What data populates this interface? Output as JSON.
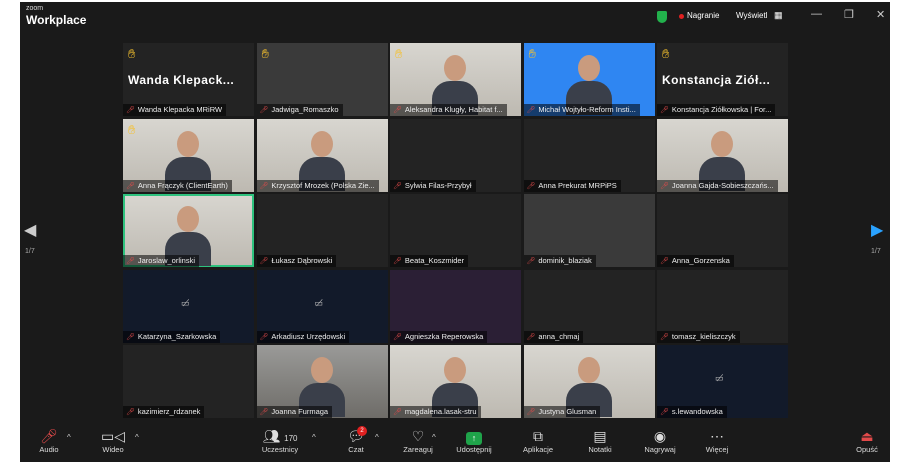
{
  "titlebar": {
    "logo_small": "zoom",
    "logo_big": "Workplace",
    "recording_label": "Nagranie",
    "view_label": "Wyświetl",
    "view_icon": "grid-icon",
    "minimize": "—",
    "restore": "❐",
    "close": "✕"
  },
  "pager": {
    "left": "1/7",
    "right": "1/7"
  },
  "participants": [
    {
      "name": "Wanda Klepacka MRiRW",
      "big": "Wanda Klepack...",
      "hand": true,
      "style": "",
      "person": false
    },
    {
      "name": "Jadwiga_Romaszko",
      "big": "",
      "hand": true,
      "style": "photo-d",
      "person": false
    },
    {
      "name": "Aleksandra Klugły, Habitat f...",
      "big": "",
      "hand": true,
      "style": "photo-w",
      "person": true
    },
    {
      "name": "Michał Wojtyło-Reform Insti...",
      "big": "",
      "hand": true,
      "style": "photo-b",
      "person": true
    },
    {
      "name": "Konstancja Ziółkowska | For...",
      "big": "Konstancja Ziół...",
      "hand": true,
      "style": "",
      "person": false
    },
    {
      "name": "Anna Frączyk (ClientEarth)",
      "big": "",
      "hand": true,
      "style": "photo-w",
      "person": true
    },
    {
      "name": "Krzysztof Mrozek (Polska Zie...",
      "big": "",
      "hand": false,
      "style": "photo-w",
      "person": true
    },
    {
      "name": "Sylwia Filas-Przybył",
      "big": "",
      "hand": false,
      "style": "",
      "person": false
    },
    {
      "name": "Anna Prekurat MRPiPS",
      "big": "",
      "hand": false,
      "style": "",
      "person": false
    },
    {
      "name": "Joanna Gajda-Sobieszczańs...",
      "big": "",
      "hand": false,
      "style": "photo-w",
      "person": true
    },
    {
      "name": "Jaroslaw_orlinski",
      "big": "",
      "hand": false,
      "style": "photo-w active",
      "person": true
    },
    {
      "name": "Łukasz Dąbrowski",
      "big": "",
      "hand": false,
      "style": "",
      "person": false
    },
    {
      "name": "Beata_Koszmider",
      "big": "",
      "hand": false,
      "style": "",
      "person": false
    },
    {
      "name": "dominik_blaziak",
      "big": "",
      "hand": false,
      "style": "photo-d",
      "person": false
    },
    {
      "name": "Anna_Gorzenska",
      "big": "",
      "hand": false,
      "style": "",
      "person": false
    },
    {
      "name": "Katarzyna_Szarkowska",
      "big": "",
      "hand": false,
      "style": "navy",
      "person": false,
      "camoff": true
    },
    {
      "name": "Arkadiusz Urzędowski",
      "big": "",
      "hand": false,
      "style": "navy",
      "person": false,
      "camoff": true
    },
    {
      "name": "Agnieszka Reperowska",
      "big": "",
      "hand": false,
      "style": "purple",
      "person": false
    },
    {
      "name": "anna_chmaj",
      "big": "",
      "hand": false,
      "style": "",
      "person": false
    },
    {
      "name": "tomasz_kieliszczyk",
      "big": "",
      "hand": false,
      "style": "",
      "person": false
    },
    {
      "name": "kazimierz_rdzanek",
      "big": "",
      "hand": false,
      "style": "",
      "person": false
    },
    {
      "name": "Joanna Furmaga",
      "big": "",
      "hand": false,
      "style": "photo-g",
      "person": true
    },
    {
      "name": "magdalena.lasak-stru",
      "big": "",
      "hand": false,
      "style": "photo-w",
      "person": true
    },
    {
      "name": "Justyna Glusman",
      "big": "",
      "hand": false,
      "style": "photo-w",
      "person": true
    },
    {
      "name": "s.lewandowska",
      "big": "",
      "hand": false,
      "style": "navy",
      "person": false,
      "camoff": true
    }
  ],
  "toolbar": {
    "audio": "Audio",
    "video": "Wideo",
    "participants": "Uczestnicy",
    "participants_count": "170",
    "chat": "Czat",
    "chat_badge": "2",
    "react": "Zareaguj",
    "share": "Udostępnij",
    "apps": "Aplikacje",
    "notes": "Notatki",
    "record": "Nagrywaj",
    "more": "Więcej",
    "leave": "Opuść"
  },
  "colors": {
    "accent_green": "#1fa34a",
    "active_border": "#2ec27e",
    "muted_red": "#e24a4a",
    "hand_yellow": "#f5c02d"
  }
}
